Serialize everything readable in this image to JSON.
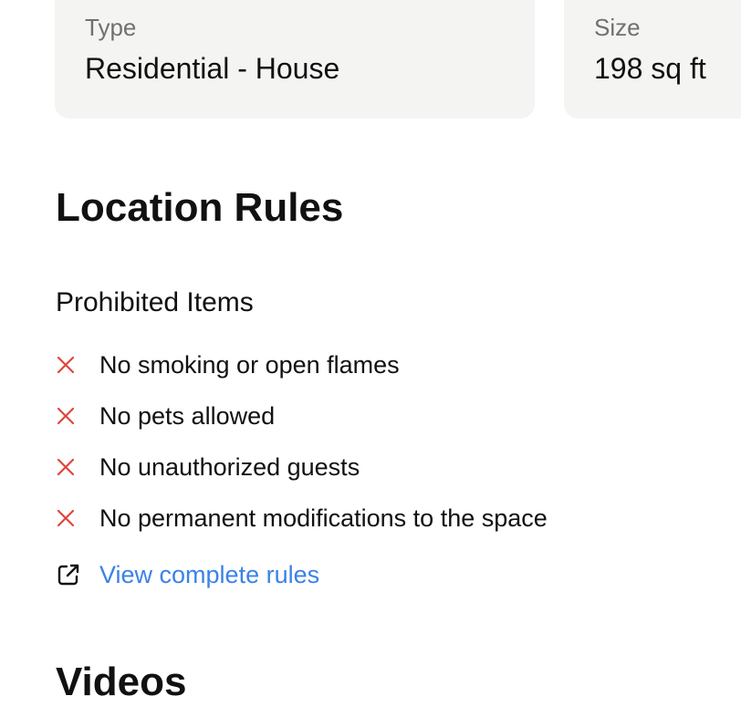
{
  "property": {
    "type_label": "Type",
    "type_value": "Residential - House",
    "size_label": "Size",
    "size_value": "198 sq ft"
  },
  "location_rules": {
    "title": "Location Rules",
    "prohibited_title": "Prohibited Items",
    "items": [
      {
        "icon": "x-icon",
        "text": "No smoking or open flames"
      },
      {
        "icon": "x-icon",
        "text": "No pets allowed"
      },
      {
        "icon": "x-icon",
        "text": "No unauthorized guests"
      },
      {
        "icon": "x-icon",
        "text": "No permanent modifications to the space"
      }
    ],
    "link": {
      "icon": "external-link-icon",
      "text": "View complete rules"
    }
  },
  "videos": {
    "title": "Videos"
  },
  "colors": {
    "prohibited_icon": "#e0463c",
    "link": "#3b82e6",
    "card_background": "#f4f4f3",
    "muted_text": "#707070"
  }
}
